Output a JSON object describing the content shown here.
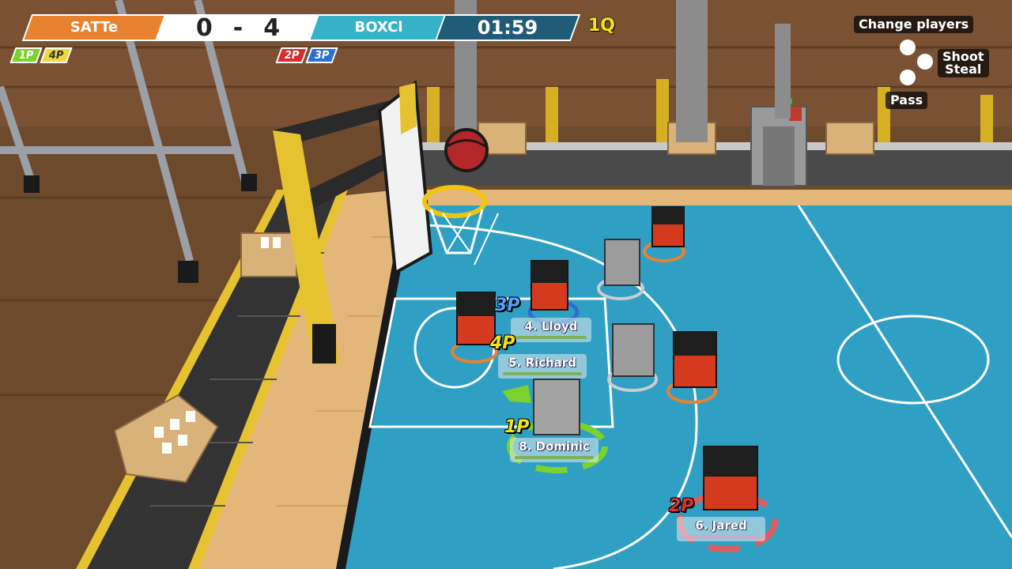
{
  "scoreboard": {
    "left_team": "SATTe",
    "left_score": "0",
    "separator": "-",
    "right_score": "4",
    "right_team": "BOXCl",
    "timer": "01:59",
    "quarter": "1Q"
  },
  "left_tags": [
    "1P",
    "4P"
  ],
  "right_tags": [
    "2P",
    "3P"
  ],
  "controls": {
    "change_players": "Change players",
    "shoot": "Shoot",
    "steal": "Steal",
    "pass": "Pass"
  },
  "players": [
    {
      "marker": "3P",
      "name": "4. Lloyd"
    },
    {
      "marker": "4P",
      "name": "5. Richard"
    },
    {
      "marker": "1P",
      "name": "8. Dominic"
    },
    {
      "marker": "2P",
      "name": "6. Jared"
    }
  ],
  "colors": {
    "team_left": "#e8822f",
    "team_right": "#36b2c8",
    "court": "#2f9fc4",
    "floor": "#e3b77a"
  }
}
